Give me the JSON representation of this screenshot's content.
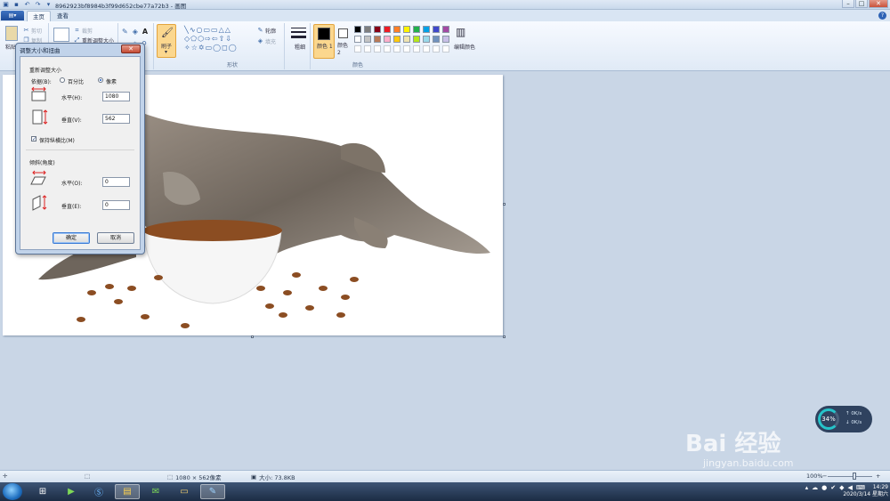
{
  "window": {
    "title": "8962923bf8984b3f99d652cbe77a72b3 - 画图",
    "min": "–",
    "max": "□",
    "close": "✕"
  },
  "tabs": [
    {
      "label": "主页"
    },
    {
      "label": "查看"
    }
  ],
  "ribbon": {
    "clipboard": {
      "paste": "粘贴",
      "cut": "剪切",
      "copy": "复制"
    },
    "image": {
      "crop": "裁剪",
      "resize": "重新调整大小"
    },
    "tools": {
      "brush": "刷子"
    },
    "shapes": {
      "outline": "轮廓",
      "fill": "填充",
      "label": "形状"
    },
    "size": {
      "label": "粗细"
    },
    "colors": {
      "color1": "颜色 1",
      "color2": "颜色 2",
      "edit": "编辑颜色",
      "label": "颜色",
      "palette_row1": [
        "#000000",
        "#7f7f7f",
        "#880015",
        "#ed1c24",
        "#ff7f27",
        "#fff200",
        "#22b14c",
        "#00a2e8",
        "#3f48cc",
        "#a349a4"
      ],
      "palette_row2": [
        "#ffffff",
        "#c3c3c3",
        "#b97a57",
        "#ffaec9",
        "#ffc90e",
        "#efe4b0",
        "#b5e61d",
        "#99d9ea",
        "#7092be",
        "#c8bfe7"
      ]
    }
  },
  "dialog": {
    "title": "调整大小和扭曲",
    "resize_section": "重新调整大小",
    "by_label": "依据(B):",
    "percent_label": "百分比",
    "pixel_label": "像素",
    "horizontal_label": "水平(H):",
    "horizontal_value": "1080",
    "vertical_label": "垂直(V):",
    "vertical_value": "562",
    "keep_ratio": "保持纵横比(M)",
    "skew_section": "倾斜(角度)",
    "skew_h_label": "水平(O):",
    "skew_h_value": "0",
    "skew_v_label": "垂直(E):",
    "skew_v_value": "0",
    "ok": "确定",
    "cancel": "取消"
  },
  "status": {
    "dimensions": "1080 × 562像素",
    "filesize": "大小: 73.8KB",
    "zoom": "100%"
  },
  "netmonitor": {
    "percent": "34%",
    "up": "0K/s",
    "down": "0K/s"
  },
  "clock": {
    "time": "14:29",
    "date": "2020/3/14 星期六"
  },
  "watermark": {
    "brand": "Bai 经验",
    "url": "jingyan.baidu.com"
  }
}
